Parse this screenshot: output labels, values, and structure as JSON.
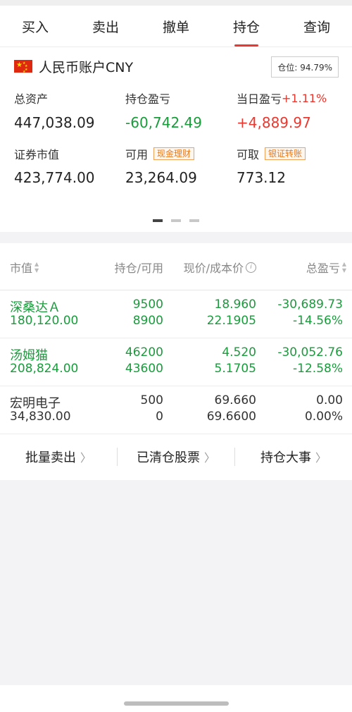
{
  "tabs": [
    {
      "label": "买入"
    },
    {
      "label": "卖出"
    },
    {
      "label": "撤单"
    },
    {
      "label": "持仓"
    },
    {
      "label": "查询"
    }
  ],
  "active_tab": "持仓",
  "account": {
    "title": "人民币账户CNY",
    "position_ratio": "仓位: 94.79%",
    "total_assets_label": "总资产",
    "total_assets": "447,038.09",
    "holding_pl_label": "持仓盈亏",
    "holding_pl": "-60,742.49",
    "today_pl_label": "当日盈亏",
    "today_pl_pct": "+1.11%",
    "today_pl": "+4,889.97",
    "market_value_label": "证券市值",
    "market_value": "423,774.00",
    "available_label": "可用",
    "available_tag": "现金理财",
    "available": "23,264.09",
    "withdrawable_label": "可取",
    "withdrawable_tag": "银证转账",
    "withdrawable": "773.12"
  },
  "pager": {
    "count": 3,
    "active": 0
  },
  "columns": {
    "market_value": "市值",
    "holding_available": "持仓/可用",
    "price_cost": "现价/成本价",
    "total_pl": "总盈亏"
  },
  "holdings": [
    {
      "name": "深桑达Ａ",
      "market_value": "180,120.00",
      "holding": "9500",
      "available": "8900",
      "price": "18.960",
      "cost": "22.1905",
      "pl": "-30,689.73",
      "pl_pct": "-14.56%",
      "color": "#1a9b3c"
    },
    {
      "name": "汤姆猫",
      "market_value": "208,824.00",
      "holding": "46200",
      "available": "43600",
      "price": "4.520",
      "cost": "5.1705",
      "pl": "-30,052.76",
      "pl_pct": "-12.58%",
      "color": "#1a9b3c"
    },
    {
      "name": "宏明电子",
      "market_value": "34,830.00",
      "holding": "500",
      "available": "0",
      "price": "69.660",
      "cost": "69.6600",
      "pl": "0.00",
      "pl_pct": "0.00%",
      "color": "#333333"
    }
  ],
  "actions": {
    "batch_sell": "批量卖出",
    "cleared_stocks": "已清仓股票",
    "holding_events": "持仓大事"
  },
  "colors": {
    "accent": "#e8382f",
    "loss": "#1a9b3c",
    "tag": "#e87a1c"
  }
}
